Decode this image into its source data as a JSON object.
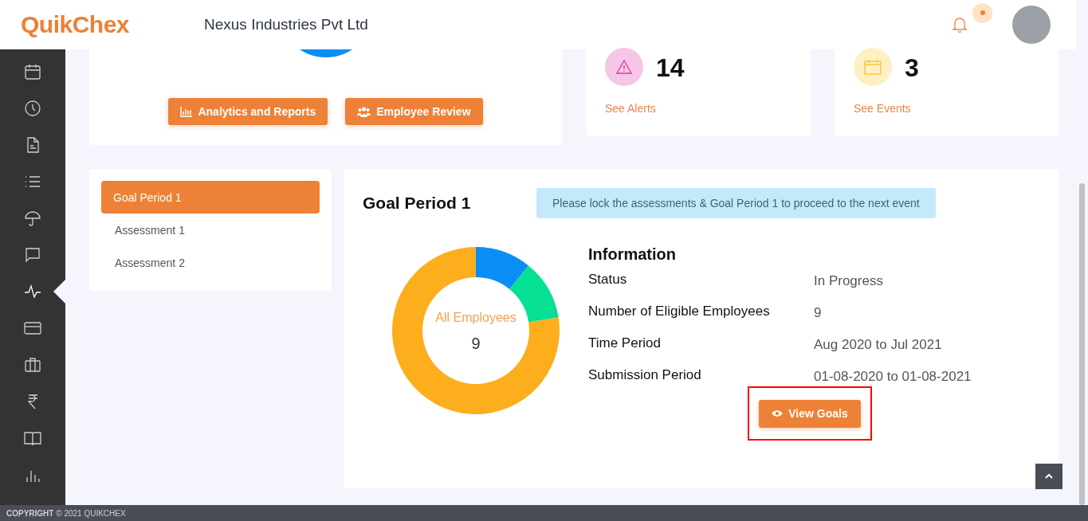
{
  "header": {
    "logo": "QuikChex",
    "company": "Nexus Industries Pvt Ltd"
  },
  "sidebar": {
    "items": [
      {
        "selected": false
      },
      {
        "selected": false
      },
      {
        "selected": false
      },
      {
        "selected": false
      },
      {
        "selected": false
      },
      {
        "selected": false
      },
      {
        "selected": true
      },
      {
        "selected": false
      },
      {
        "selected": false
      },
      {
        "selected": false
      },
      {
        "selected": false
      },
      {
        "selected": false
      }
    ]
  },
  "top_actions": [
    "Analytics and Reports",
    "Employee Review"
  ],
  "stat_cards": [
    {
      "kind": "alerts",
      "count": "14",
      "link": "See Alerts"
    },
    {
      "kind": "events",
      "count": "3",
      "link": "See Events"
    }
  ],
  "periods": [
    {
      "label": "Goal Period 1",
      "selected": true
    },
    {
      "label": "Assessment 1",
      "selected": false
    },
    {
      "label": "Assessment 2",
      "selected": false
    }
  ],
  "detail": {
    "title": "Goal Period 1",
    "notice": "Please lock the assessments & Goal Period 1 to proceed to the next event",
    "donut": {
      "label": "All Employees",
      "total": "9"
    },
    "info_title": "Information",
    "info": [
      {
        "label": "Status",
        "value": "In Progress"
      },
      {
        "label": "Number of Eligible Employees",
        "value": "9"
      },
      {
        "label": "Time Period",
        "value": "Aug 2020 to Jul 2021"
      },
      {
        "label": "Submission Period",
        "value": "01-08-2020 to 01-08-2021"
      }
    ],
    "button": "View Goals"
  },
  "footer": "**COPYRIGHT** © 2021 QUIKCHEX"
}
